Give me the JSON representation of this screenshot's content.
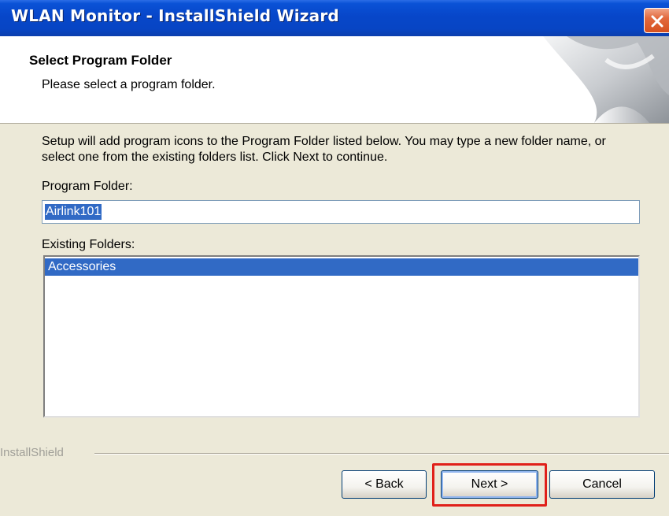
{
  "window": {
    "title": "WLAN Monitor - InstallShield Wizard",
    "close_icon": "close-icon"
  },
  "header": {
    "title": "Select Program Folder",
    "subtitle": "Please select a program folder."
  },
  "main": {
    "description": "Setup will add program icons to the Program Folder listed below.  You may type a new folder name, or select one from the existing folders list.  Click Next to continue.",
    "program_folder_label": "Program Folder:",
    "program_folder_value": "Airlink101",
    "existing_folders_label": "Existing Folders:",
    "existing_folders": [
      "Accessories"
    ]
  },
  "footer": {
    "brand": "InstallShield",
    "back_label": "< Back",
    "next_label": "Next >",
    "cancel_label": "Cancel"
  },
  "colors": {
    "titlebar": "#0a52d6",
    "selection": "#316ac5",
    "highlight": "#e0201a"
  }
}
